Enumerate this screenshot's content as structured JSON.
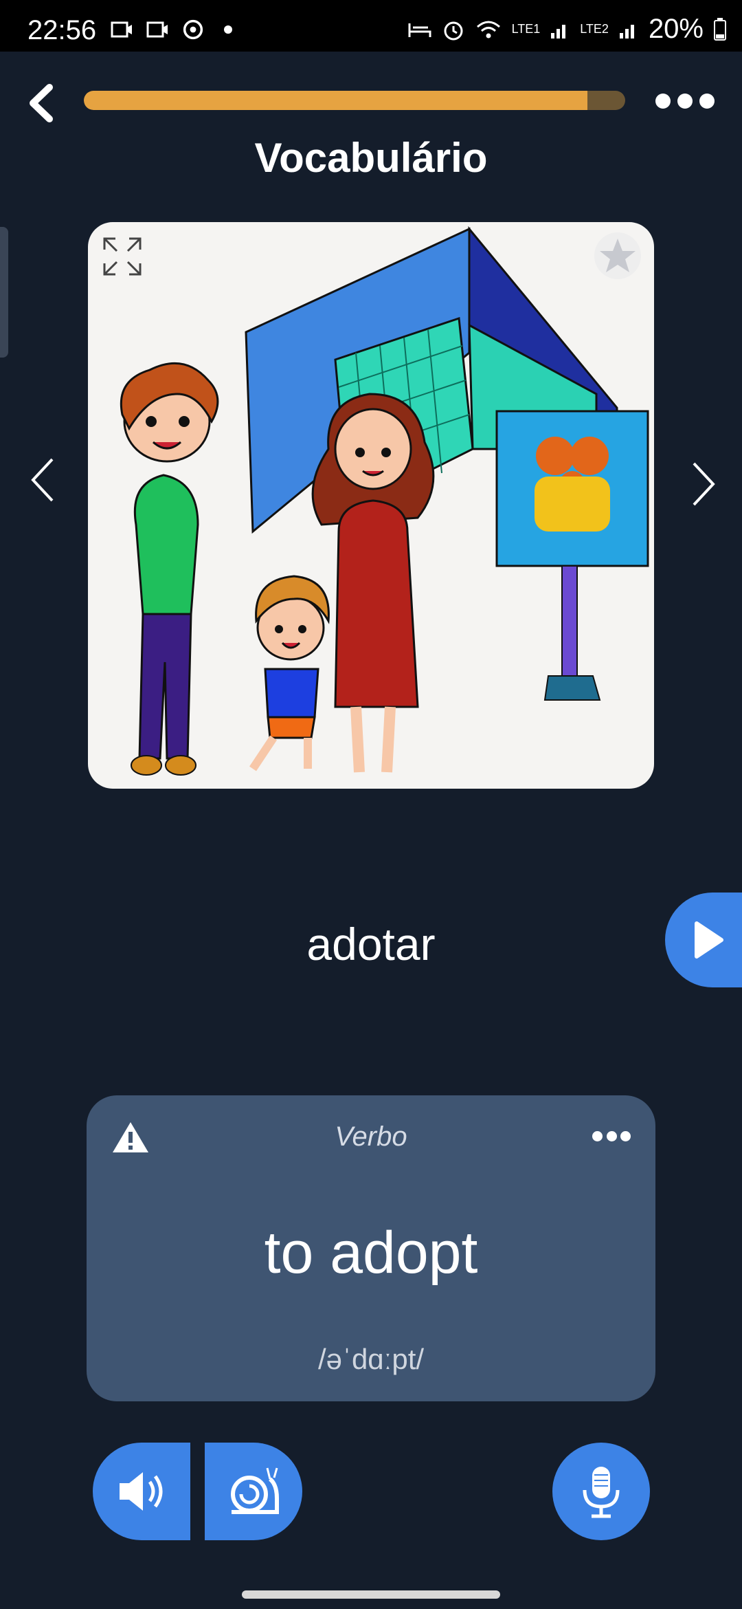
{
  "status_bar": {
    "time": "22:56",
    "battery_percent": "20%",
    "network_1": "LTE1",
    "network_2": "LTE2"
  },
  "header": {
    "title": "Vocabulário",
    "progress": 0.93
  },
  "flashcard": {
    "word": "adotar",
    "part_of_speech": "Verbo",
    "translation": "to adopt",
    "phonetic": "/əˈdɑːpt/"
  },
  "colors": {
    "background": "#141d2b",
    "accent_blue": "#3d83e6",
    "progress_fill": "#e6a341",
    "progress_track": "#6b5634",
    "card_bg": "#3f5572"
  },
  "icons": {
    "back": "chevron-left-icon",
    "more": "more-dots-icon",
    "expand": "expand-icon",
    "favorite": "star-icon",
    "prev": "chevron-left-icon",
    "next": "chevron-right-icon",
    "play": "play-icon",
    "warning": "warning-icon",
    "audio": "speaker-icon",
    "slow_audio": "snail-icon",
    "record": "microphone-icon"
  }
}
